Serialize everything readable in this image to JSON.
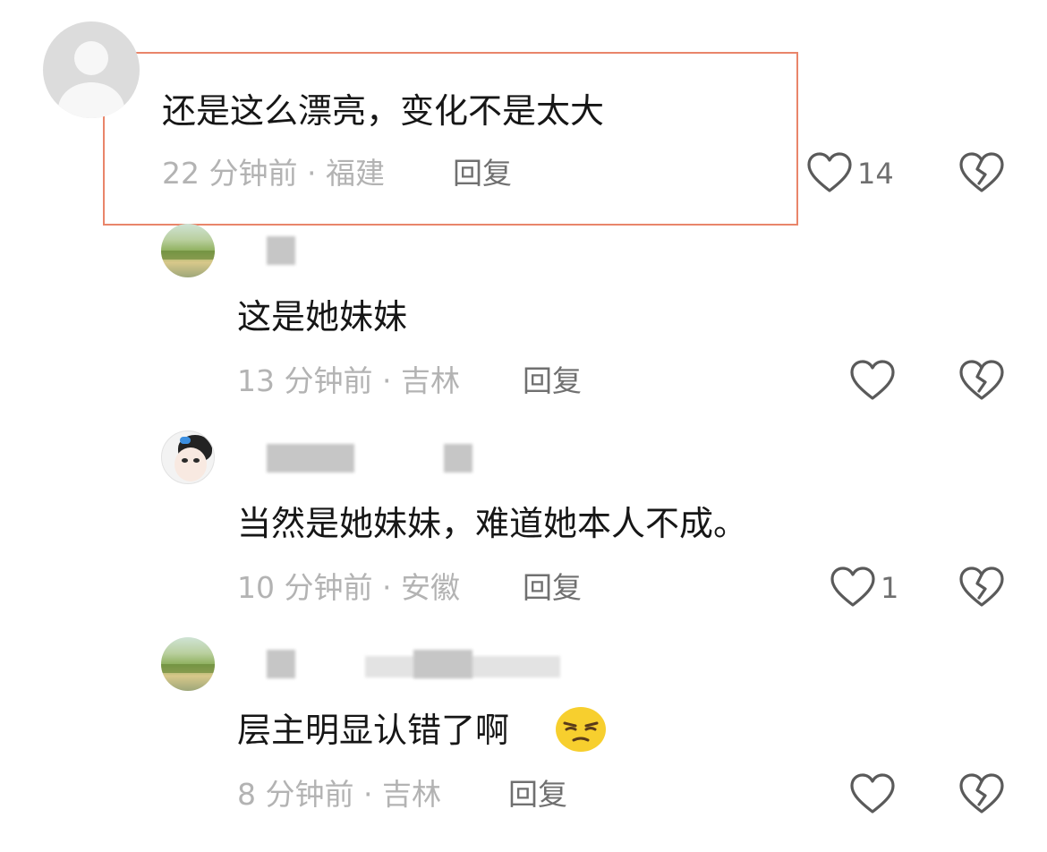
{
  "comments": [
    {
      "text": "还是这么漂亮，变化不是太大",
      "meta": "22 分钟前 · 福建",
      "reply": "回复",
      "likes": "14",
      "avatar": "default-user-avatar",
      "highlighted": true
    },
    {
      "text": "这是她妹妹",
      "meta": "13 分钟前 · 吉林",
      "reply": "回复",
      "likes": "",
      "avatar": "landscape-avatar"
    },
    {
      "text": "当然是她妹妹，难道她本人不成。",
      "meta": "10 分钟前 · 安徽",
      "reply": "回复",
      "likes": "1",
      "avatar": "cartoon-face-avatar"
    },
    {
      "text": "层主明显认错了啊",
      "meta": "8 分钟前 · 吉林",
      "reply": "回复",
      "likes": "",
      "avatar": "landscape-avatar",
      "emoji": "smirk-emoji"
    }
  ],
  "colors": {
    "highlight_border": "#e9856a",
    "meta_text": "#b3b3b3",
    "reply_text": "#707070",
    "icon_stroke": "#5a5a5a"
  },
  "icons": {
    "like": "heart-outline-icon",
    "dislike": "broken-heart-icon"
  }
}
